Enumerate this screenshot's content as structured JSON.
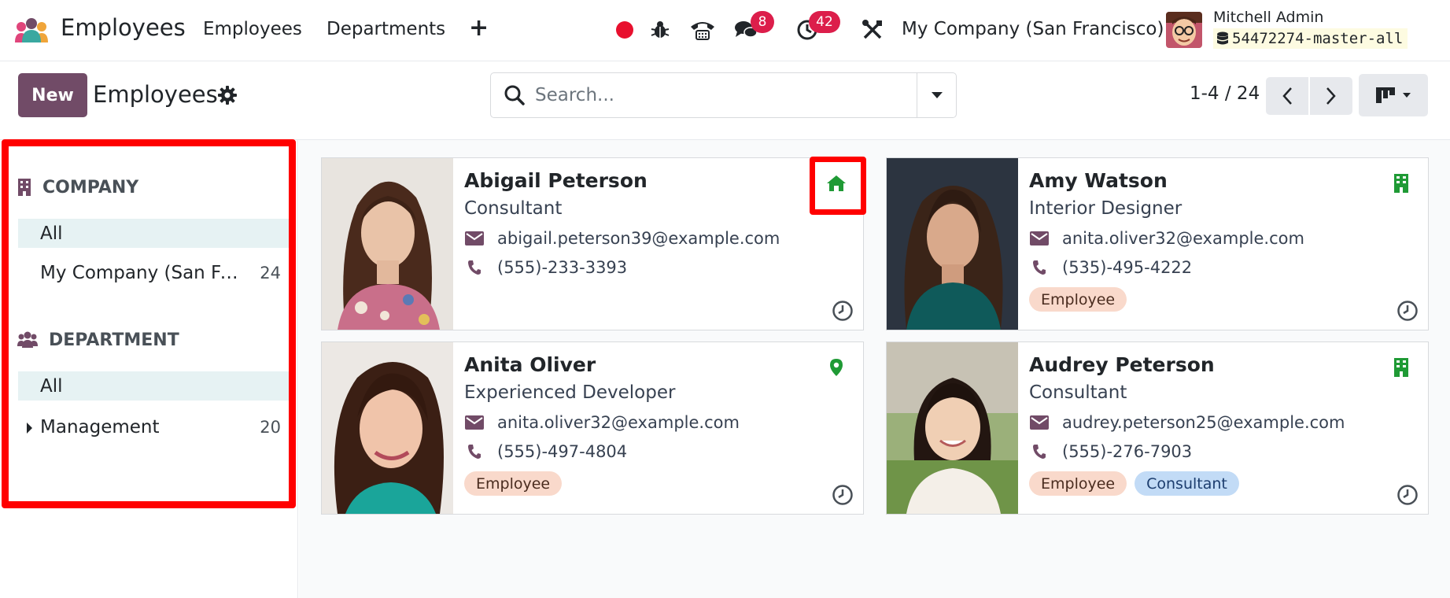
{
  "navbar": {
    "app_name": "Employees",
    "menu": [
      "Employees",
      "Departments"
    ],
    "plus_label": "+",
    "messages_count": "8",
    "activities_count": "42",
    "company": "My Company (San Francisco)",
    "user_name": "Mitchell Admin",
    "database": "54472274-master-all"
  },
  "control_panel": {
    "new_label": "New",
    "breadcrumb": "Employees",
    "search_placeholder": "Search...",
    "pager": "1-4 / 24"
  },
  "sidebar": {
    "company_title": "COMPANY",
    "company_items": [
      {
        "label": "All",
        "count": ""
      },
      {
        "label": "My Company (San Francisco)",
        "count": "24"
      }
    ],
    "department_title": "DEPARTMENT",
    "department_items": [
      {
        "label": "All",
        "count": ""
      },
      {
        "label": "Management",
        "count": "20"
      }
    ]
  },
  "employees": [
    {
      "name": "Abigail Peterson",
      "job": "Consultant",
      "email": "abigail.peterson39@example.com",
      "phone": "(555)-233-3393",
      "tags": [],
      "work_location": "home-icon"
    },
    {
      "name": "Amy Watson",
      "job": "Interior Designer",
      "email": "anita.oliver32@example.com",
      "phone": "(535)-495-4222",
      "tags": [
        "Employee"
      ],
      "work_location": "building-icon"
    },
    {
      "name": "Anita Oliver",
      "job": "Experienced Developer",
      "email": "anita.oliver32@example.com",
      "phone": "(555)-497-4804",
      "tags": [
        "Employee"
      ],
      "work_location": "map-marker-icon"
    },
    {
      "name": "Audrey Peterson",
      "job": "Consultant",
      "email": "audrey.peterson25@example.com",
      "phone": "(555)-276-7903",
      "tags": [
        "Employee",
        "Consultant"
      ],
      "work_location": "building-icon"
    }
  ],
  "colors": {
    "brand": "#714b67",
    "status_green": "#1f9a35",
    "badge_red": "#dc1e4b",
    "tag_employee": "#f9d9cb",
    "tag_consultant": "#c2dbf6",
    "highlight": "#ff0000"
  }
}
